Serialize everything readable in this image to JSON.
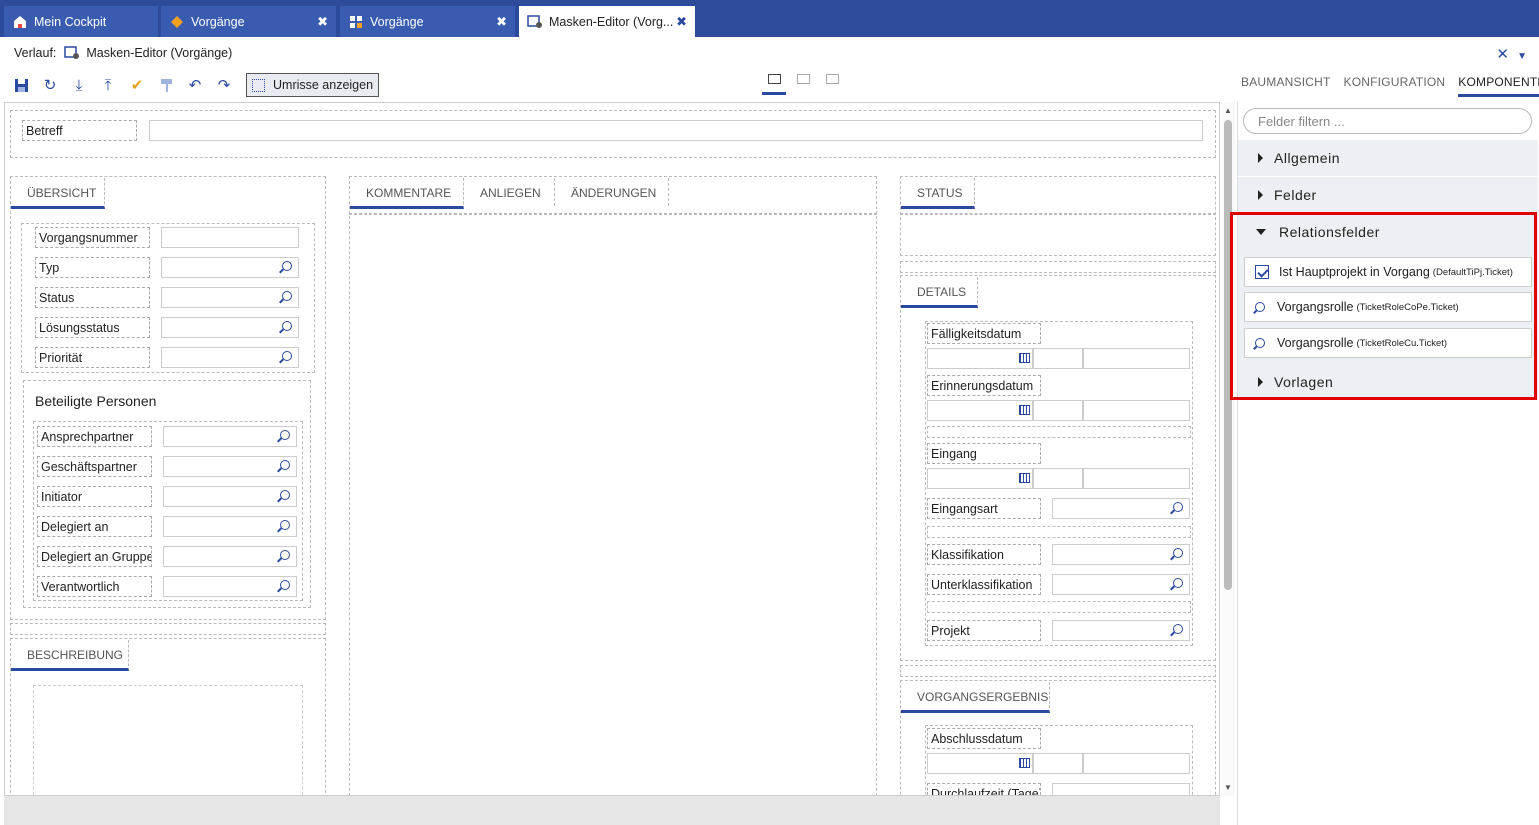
{
  "tabs": [
    {
      "label": "Mein Cockpit",
      "icon": "home-icon"
    },
    {
      "label": "Vorgänge",
      "icon": "ticket-icon",
      "close": "✖"
    },
    {
      "label": "Vorgänge",
      "icon": "grid-icon",
      "close": "✖"
    },
    {
      "label": "Masken-Editor (Vorg...",
      "icon": "form-editor-icon",
      "close": "✖"
    }
  ],
  "history": {
    "label": "Verlauf:",
    "current": "Masken-Editor (Vorgänge)"
  },
  "toolbar": {
    "outline_label": "Umrisse anzeigen"
  },
  "right_tabs": [
    "BAUMANSICHT",
    "KONFIGURATION",
    "KOMPONENTEN"
  ],
  "subject": {
    "label": "Betreff"
  },
  "overview": {
    "tab": "ÜBERSICHT",
    "fields": [
      "Vorgangsnummer",
      "Typ",
      "Status",
      "Lösungsstatus",
      "Priorität"
    ],
    "persons_title": "Beteiligte Personen",
    "persons": [
      "Ansprechpartner",
      "Geschäftspartner",
      "Initiator",
      "Delegiert an",
      "Delegiert an Gruppe",
      "Verantwortlich"
    ]
  },
  "description": {
    "tab": "BESCHREIBUNG"
  },
  "center_tabs": [
    "KOMMENTARE",
    "ANLIEGEN",
    "ÄNDERUNGEN"
  ],
  "status": {
    "tab": "STATUS"
  },
  "details": {
    "tab": "DETAILS",
    "date_fields": [
      "Fälligkeitsdatum",
      "Erinnerungsdatum",
      "Eingang"
    ],
    "lookup_fields": [
      "Eingangsart",
      "Klassifikation",
      "Unterklassifikation",
      "Projekt"
    ]
  },
  "result": {
    "tab": "VORGANGSERGEBNIS",
    "fields": [
      "Abschlussdatum",
      "Durchlaufzeit (Tage)"
    ]
  },
  "panel": {
    "filter_placeholder": "Felder filtern ...",
    "categories": [
      "Allgemein",
      "Felder",
      "Relationsfelder",
      "Vorlagen"
    ],
    "relation_items": [
      {
        "label": "Ist Hauptprojekt in Vorgang",
        "tech": "(DefaultTiPj.Ticket)",
        "icon": "checkbox-icon"
      },
      {
        "label": "Vorgangsrolle",
        "tech": "(TicketRoleCoPe.Ticket)",
        "icon": "lookup-icon"
      },
      {
        "label": "Vorgangsrolle",
        "tech": "(TicketRoleCu.Ticket)",
        "icon": "lookup-icon"
      }
    ]
  }
}
